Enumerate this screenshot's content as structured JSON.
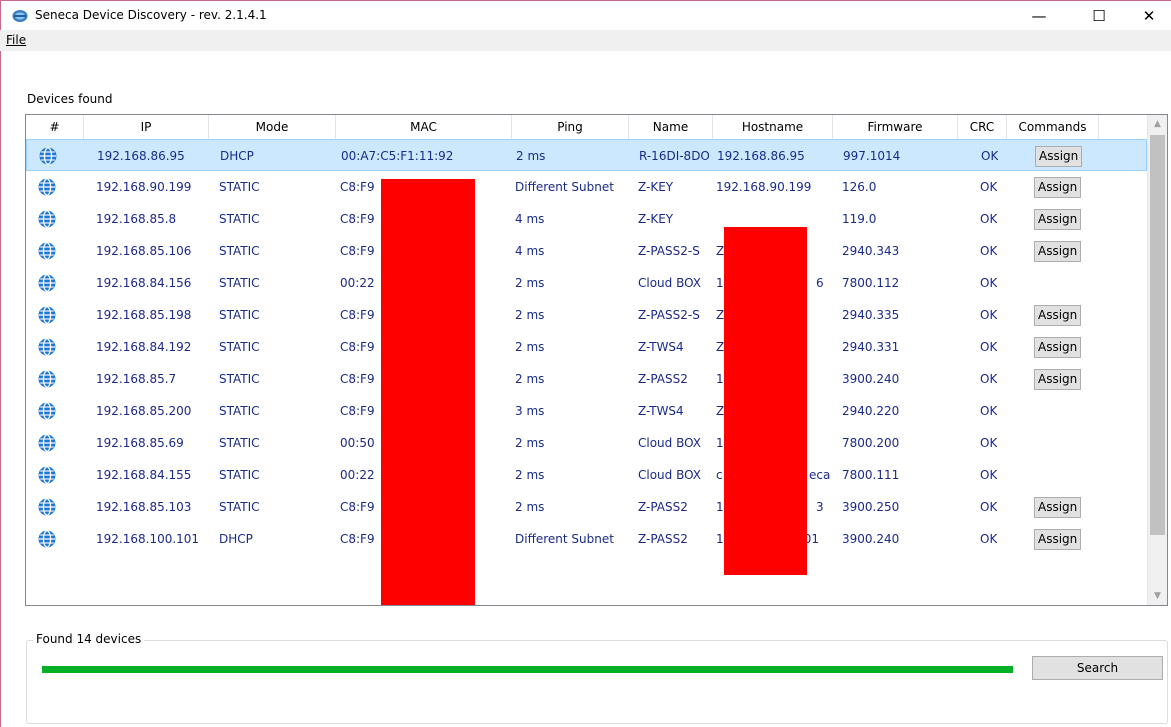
{
  "window": {
    "title": "Seneca Device Discovery - rev. 2.1.4.1",
    "minimize": "—",
    "maximize": "☐",
    "close": "✕"
  },
  "menu": {
    "file": "File"
  },
  "devices": {
    "label": "Devices found",
    "columns": [
      "#",
      "IP",
      "Mode",
      "MAC",
      "Ping",
      "Name",
      "Hostname",
      "Firmware",
      "CRC",
      "Commands"
    ],
    "assign_label": "Assign",
    "rows": [
      {
        "ip": "192.168.86.95",
        "mode": "DHCP",
        "mac": "00:A7:C5:F1:11:92",
        "ping": "2 ms",
        "name": "R-16DI-8DO",
        "hostname": "192.168.86.95",
        "firmware": "997.1014",
        "crc": "OK",
        "assign": true
      },
      {
        "ip": "192.168.90.199",
        "mode": "STATIC",
        "mac": "C8:F9",
        "ping": "Different Subnet",
        "name": "Z-KEY",
        "hostname": "192.168.90.199",
        "firmware": "126.0",
        "crc": "OK",
        "assign": true
      },
      {
        "ip": "192.168.85.8",
        "mode": "STATIC",
        "mac": "C8:F9",
        "ping": "4 ms",
        "name": "Z-KEY",
        "hostname": "",
        "firmware": "119.0",
        "crc": "OK",
        "assign": true
      },
      {
        "ip": "192.168.85.106",
        "mode": "STATIC",
        "mac": "C8:F9",
        "ping": "4 ms",
        "name": "Z-PASS2-S",
        "hostname": "Z",
        "firmware": "2940.343",
        "crc": "OK",
        "assign": true
      },
      {
        "ip": "192.168.84.156",
        "mode": "STATIC",
        "mac": "00:22",
        "ping": "2 ms",
        "name": "Cloud BOX",
        "hostname": "1",
        "hostname_tail": "6",
        "firmware": "7800.112",
        "crc": "OK",
        "assign": false
      },
      {
        "ip": "192.168.85.198",
        "mode": "STATIC",
        "mac": "C8:F9",
        "ping": "2 ms",
        "name": "Z-PASS2-S",
        "hostname": "Z",
        "firmware": "2940.335",
        "crc": "OK",
        "assign": true
      },
      {
        "ip": "192.168.84.192",
        "mode": "STATIC",
        "mac": "C8:F9",
        "ping": "2 ms",
        "name": "Z-TWS4",
        "hostname": "Z",
        "firmware": "2940.331",
        "crc": "OK",
        "assign": true
      },
      {
        "ip": "192.168.85.7",
        "mode": "STATIC",
        "mac": "C8:F9",
        "ping": "2 ms",
        "name": "Z-PASS2",
        "hostname": "1",
        "firmware": "3900.240",
        "crc": "OK",
        "assign": true
      },
      {
        "ip": "192.168.85.200",
        "mode": "STATIC",
        "mac": "C8:F9",
        "ping": "3 ms",
        "name": "Z-TWS4",
        "hostname": "Z",
        "firmware": "2940.220",
        "crc": "OK",
        "assign": false
      },
      {
        "ip": "192.168.85.69",
        "mode": "STATIC",
        "mac": "00:50",
        "ping": "2 ms",
        "name": "Cloud BOX",
        "hostname": "1",
        "firmware": "7800.200",
        "crc": "OK",
        "assign": false
      },
      {
        "ip": "192.168.84.155",
        "mode": "STATIC",
        "mac": "00:22",
        "ping": "2 ms",
        "name": "Cloud BOX",
        "hostname": "c",
        "hostname_tail": "eca",
        "firmware": "7800.111",
        "crc": "OK",
        "assign": false
      },
      {
        "ip": "192.168.85.103",
        "mode": "STATIC",
        "mac": "C8:F9",
        "ping": "2 ms",
        "name": "Z-PASS2",
        "hostname": "1",
        "hostname_tail": "3",
        "firmware": "3900.250",
        "crc": "OK",
        "assign": true
      },
      {
        "ip": "192.168.100.101",
        "mode": "DHCP",
        "mac": "C8:F9",
        "ping": "Different Subnet",
        "name": "Z-PASS2",
        "hostname": "192.168.100.101",
        "firmware": "3900.240",
        "crc": "OK",
        "assign": true
      }
    ]
  },
  "footer": {
    "found_label": "Found 14 devices",
    "progress": 1.0,
    "progress_color": "#06b025",
    "search_label": "Search"
  },
  "colors": {
    "row_text": "#1a2a8a",
    "selected_row": "#cce8ff",
    "redaction": "#ff0000"
  }
}
